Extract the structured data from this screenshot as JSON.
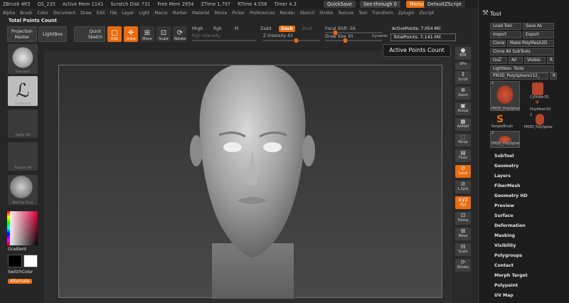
{
  "title_bar": {
    "app": "ZBrush 4R5",
    "qs": "QS_235",
    "active_mem": "Active Mem 1141",
    "scratch_disk": "Scratch Disk 731",
    "free_mem": "Free Mem 2954",
    "ztime": "ZTime 1.797",
    "rtime": "RTime 4.558",
    "timer": "Timer 4.3",
    "quicksave": "QuickSave",
    "see_through": "See-through 0",
    "menus": "Menus",
    "default_script": "DefaultZScript"
  },
  "menu_bar": [
    "Alpha",
    "Brush",
    "Color",
    "Document",
    "Draw",
    "Edit",
    "File",
    "Layer",
    "Light",
    "Macro",
    "Marker",
    "Material",
    "Movie",
    "Picker",
    "Preferences",
    "Render",
    "Stencil",
    "Stroke",
    "Texture",
    "Tool",
    "Transform",
    "Zplugin",
    "Zscript"
  ],
  "shelf": {
    "total_points_label": "Total Points Count",
    "projection_master": "Projection Master",
    "lightbox": "LightBox",
    "quick_sketch": "Quick Sketch",
    "edit": "Edit",
    "draw": "Draw",
    "move": "Move",
    "scale": "Scale",
    "rotate": "Rotate",
    "mrgb": "Mrgb",
    "rgb": "Rgb",
    "m": "M",
    "zadd": "Zadd",
    "zsub": "Zsub",
    "zcut": "Zcut",
    "rgb_intensity": "Rgb Intensity",
    "z_intensity": "Z Intensity 43",
    "focal_shift": "Focal Shift -56",
    "draw_size": "Draw Size 30",
    "dynamic": "Dynamic",
    "active_points": "ActivePoints: 7.054 Mil",
    "total_points": "TotalPoints: 7.141 Mil"
  },
  "tooltip": "Active Points Count",
  "left_tray": {
    "standard": "Standard",
    "freehand": "FreeHand",
    "alpha_off": "Alpha Off",
    "texture_off": "Texture Off",
    "matcap": "MatCap Gray",
    "gradient": "Gradient",
    "switch_color": "SwitchColor",
    "alternate": "Alternate"
  },
  "right_shelf": [
    "BPR",
    "SPix",
    "Scroll",
    "Zoom",
    "Actual",
    "AAHalf",
    "Persp",
    "Floor",
    "Local",
    "L.Sym",
    "Xyz",
    "Frame",
    "Move",
    "Scale",
    "Rotate"
  ],
  "tool_palette": {
    "title": "Tool",
    "load_tool": "Load Tool",
    "save_as": "Save As",
    "import": "Import",
    "export": "Export",
    "clone": "Clone",
    "make_polymesh": "Make PolyMesh3D",
    "clone_all": "Clone All SubTools",
    "goz": "GoZ",
    "all": "All",
    "visible": "Visible",
    "r": "R",
    "lightbox_tools": "Lightbox› Tools",
    "current_tool": "PM3D_PolySphere112_",
    "thumbs": [
      {
        "label": "PM3D_PolySpher",
        "count": "2"
      },
      {
        "label": "Cylinder3D",
        "count": ""
      },
      {
        "label": "PolyMesh3D",
        "count": ""
      },
      {
        "label": "SimpleBrush",
        "count": ""
      },
      {
        "label": "PM3D_PolySpher",
        "count": "2"
      },
      {
        "label": "PM3D_PolySpher",
        "count": "2"
      }
    ],
    "sections": [
      "SubTool",
      "Geometry",
      "Layers",
      "FiberMesh",
      "Geometry HD",
      "Preview",
      "Surface",
      "Deformation",
      "Masking",
      "Visibility",
      "Polygroups",
      "Contact",
      "Morph Target",
      "Polypaint",
      "UV Map"
    ]
  },
  "colors": {
    "accent": "#e86c10",
    "background": "#262626",
    "panel": "#1d1d1d"
  }
}
